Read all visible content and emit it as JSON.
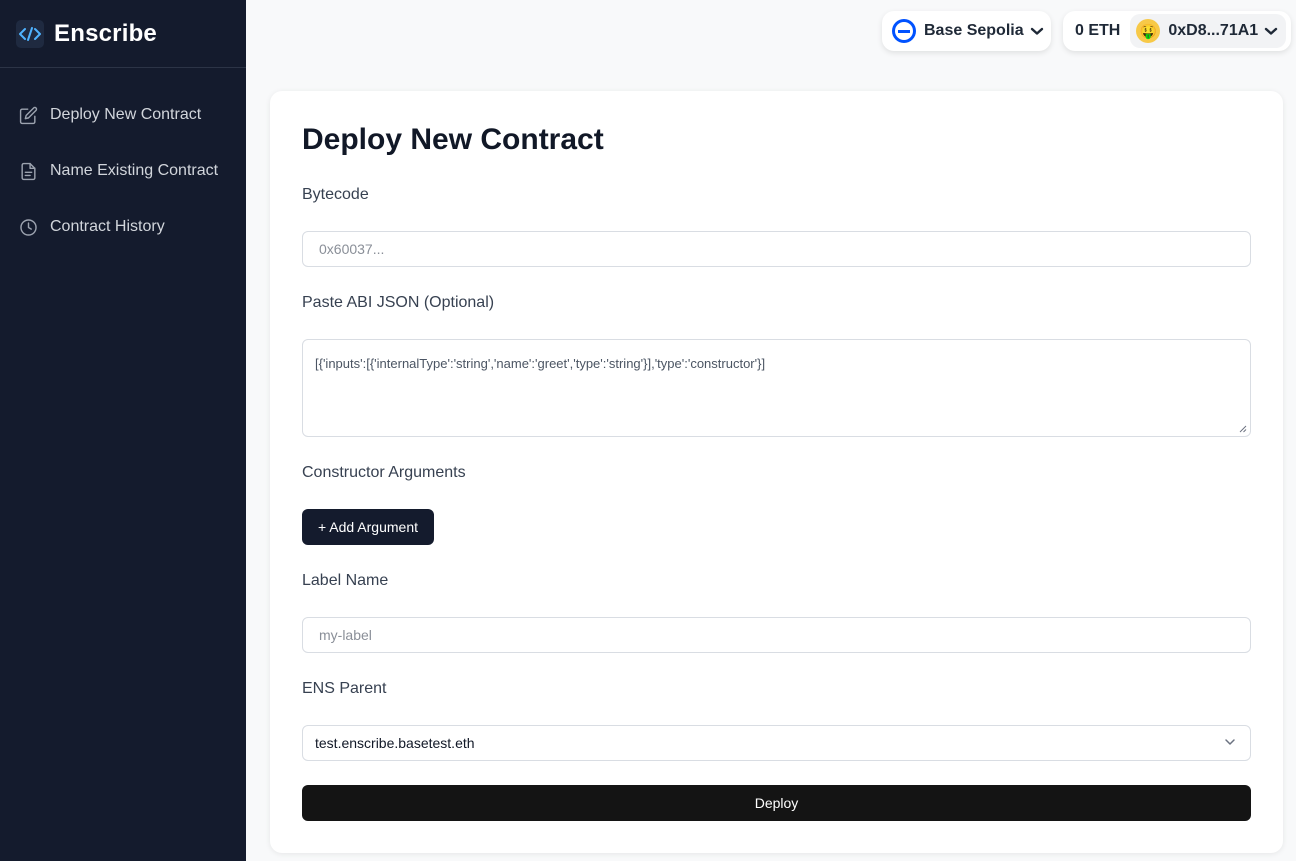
{
  "brand": {
    "name": "Enscribe",
    "logo_icon": "code-icon"
  },
  "sidebar": {
    "items": [
      {
        "label": "Deploy New Contract",
        "icon": "edit-icon"
      },
      {
        "label": "Name Existing Contract",
        "icon": "document-icon"
      },
      {
        "label": "Contract History",
        "icon": "clock-icon"
      }
    ]
  },
  "topbar": {
    "network": "Base Sepolia",
    "balance": "0 ETH",
    "account": "0xD8...71A1",
    "avatar_emoji": "🤑"
  },
  "form": {
    "title": "Deploy New Contract",
    "bytecode_label": "Bytecode",
    "bytecode_placeholder": "0x60037...",
    "abi_label": "Paste ABI JSON (Optional)",
    "abi_placeholder": "[{'inputs':[{'internalType':'string','name':'greet','type':'string'}],'type':'constructor'}]",
    "constructor_label": "Constructor Arguments",
    "add_argument_label": "+ Add Argument",
    "label_name_label": "Label Name",
    "label_name_placeholder": "my-label",
    "ens_parent_label": "ENS Parent",
    "ens_parent_value": "test.enscribe.basetest.eth",
    "deploy_label": "Deploy"
  }
}
